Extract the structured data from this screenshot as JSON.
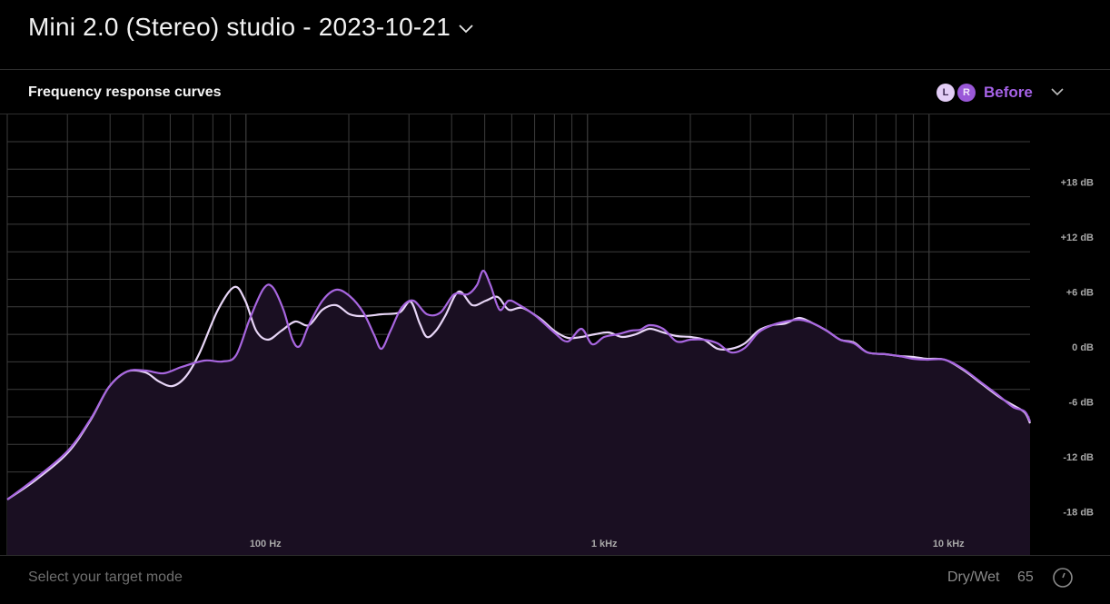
{
  "header": {
    "title": "Mini 2.0 (Stereo) studio - 2023-10-21",
    "chevron_icon": "chevron-down-icon"
  },
  "panel": {
    "title": "Frequency response curves",
    "channels": [
      {
        "label": "L",
        "color": "#e3cdf6"
      },
      {
        "label": "R",
        "color": "#9a58d8"
      }
    ],
    "mode_label": "Before",
    "mode_chevron_icon": "chevron-down-icon"
  },
  "graph": {
    "freq_labels": [
      "100 Hz",
      "1 kHz",
      "10 kHz"
    ],
    "db_labels": [
      "+18 dB",
      "+12 dB",
      "+6 dB",
      "0 dB",
      "-6 dB",
      "-12 dB",
      "-18 dB"
    ],
    "colors": {
      "left_curve": "#e8d6f7",
      "right_curve": "#a866e0",
      "fill": "#1a0f22",
      "grid": "#3c3c3c"
    }
  },
  "footer": {
    "target_mode_placeholder": "Select your target mode",
    "drywet_label": "Dry/Wet",
    "drywet_value": "65",
    "knob_icon": "knob-icon"
  }
}
